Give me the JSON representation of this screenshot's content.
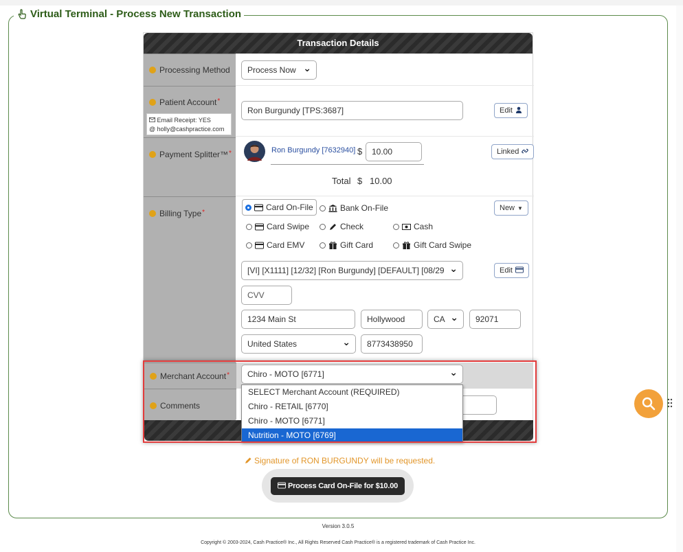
{
  "page": {
    "legend_title": "Virtual Terminal - Process New Transaction",
    "panel_title": "Transaction Details"
  },
  "labels": {
    "processing_method": "Processing Method",
    "patient_account": "Patient Account",
    "email_receipt": "Email Receipt: YES",
    "email_address": "holly@cashpractice.com",
    "payment_splitter": "Payment Splitter™",
    "billing_type": "Billing Type",
    "merchant_account": "Merchant Account",
    "comments": "Comments",
    "required_mark": "*"
  },
  "processing": {
    "method_value": "Process Now"
  },
  "patient": {
    "account_value": "Ron Burgundy [TPS:3687]",
    "edit_label": "Edit"
  },
  "splitter": {
    "patient_link": "Ron Burgundy [7632940]",
    "currency": "$",
    "amount": "10.00",
    "linked_label": "Linked",
    "total_label": "Total",
    "total_currency": "$",
    "total_value": "10.00"
  },
  "billing": {
    "options": [
      {
        "label": "Card On-File",
        "selected": true
      },
      {
        "label": "Bank On-File"
      },
      {
        "label": "Card Swipe"
      },
      {
        "label": "Check"
      },
      {
        "label": "Cash"
      },
      {
        "label": "Card EMV"
      },
      {
        "label": "Gift Card"
      },
      {
        "label": "Gift Card Swipe"
      }
    ],
    "new_label": "New",
    "card_value": "[VI] [X1111] [12/32] [Ron Burgundy] [DEFAULT] [08/29",
    "card_edit_label": "Edit",
    "cvv_placeholder": "CVV",
    "address": "1234 Main St",
    "city": "Hollywood",
    "state": "CA",
    "zip": "92071",
    "country": "United States",
    "phone": "8773438950"
  },
  "merchant": {
    "selected": "Chiro - MOTO [6771]",
    "options": [
      "SELECT Merchant Account (REQUIRED)",
      "Chiro - RETAIL [6770]",
      "Chiro - MOTO [6771]",
      "Nutrition - MOTO [6769]"
    ],
    "highlighted_index": 3
  },
  "footer": {
    "signature_notice": "Signature of RON BURGUNDY will be requested.",
    "process_button": "Process Card On-File for $10.00",
    "version": "Version 3.0.5",
    "copyright": "Copyright © 2003-2024, Cash Practice® Inc., All Rights Reserved Cash Practice® is a registered trademark of Cash Practice Inc."
  },
  "colors": {
    "legend_green": "#2d5c18",
    "highlight_red": "#e23b3b",
    "dropdown_active": "#1967d2",
    "fab_orange": "#f2a13a"
  }
}
